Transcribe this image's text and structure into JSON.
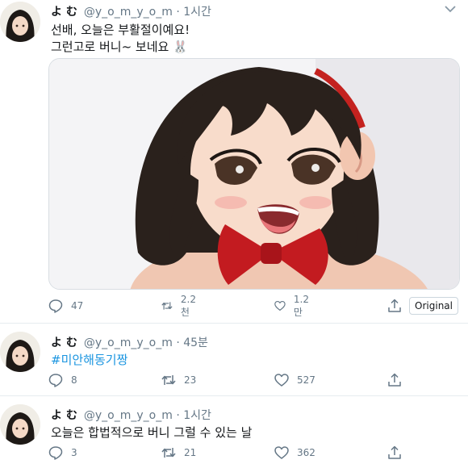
{
  "tweets": [
    {
      "name": "よ む",
      "handle": "@y_o_m_y_o_m",
      "dot": "·",
      "time": "1시간",
      "line1": "선배, 오늘은 부활절이예요!",
      "line2": "그런고로 버니~ 보네요",
      "emoji": "🐰",
      "replies": "47",
      "retweets": "2.2천",
      "likes": "1.2만",
      "original_label": "Original"
    },
    {
      "name": "よ む",
      "handle": "@y_o_m_y_o_m",
      "dot": "·",
      "time": "45분",
      "hashtag": "#미안해동기짱",
      "replies": "8",
      "retweets": "23",
      "likes": "527"
    },
    {
      "name": "よ む",
      "handle": "@y_o_m_y_o_m",
      "dot": "·",
      "time": "1시간",
      "text": "오늘은 합법적으로 버니 그럴 수 있는 날",
      "replies": "3",
      "retweets": "21",
      "likes": "362"
    }
  ],
  "colors": {
    "link": "#1b95e0",
    "muted": "#657786",
    "divider": "#e6ecf0"
  },
  "icons": [
    "avatar-icon",
    "chevron-down-icon",
    "reply-icon",
    "retweet-icon",
    "like-icon",
    "share-icon"
  ]
}
